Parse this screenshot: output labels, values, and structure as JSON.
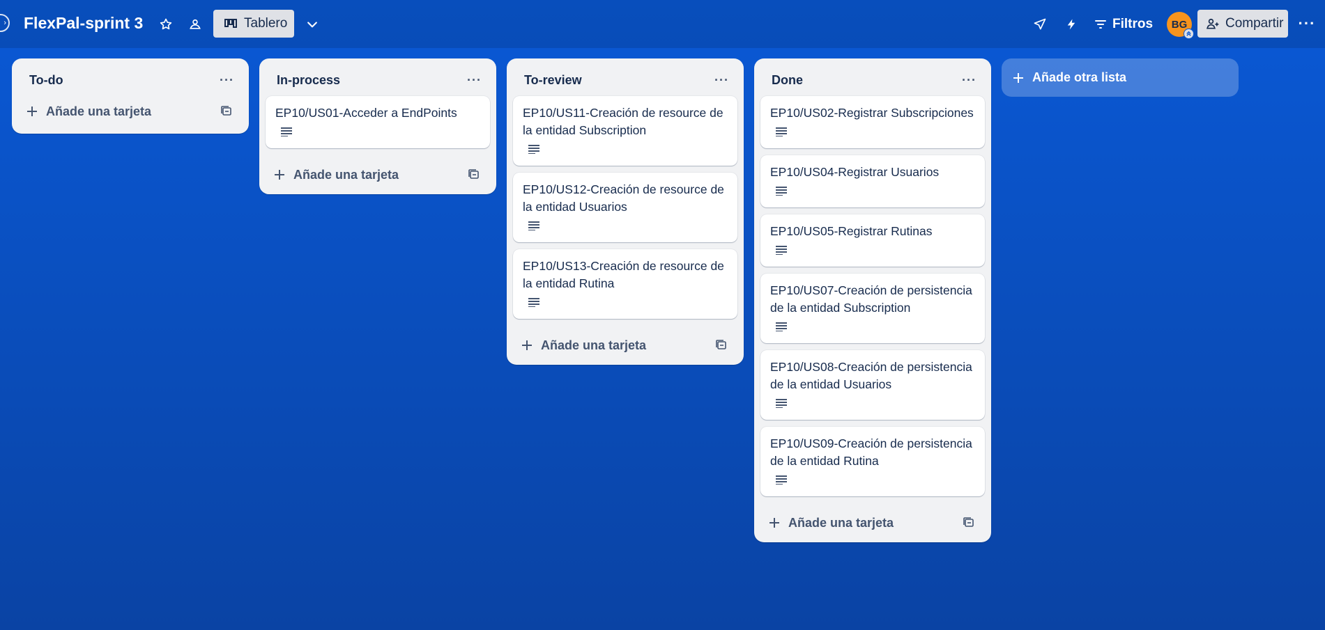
{
  "board": {
    "title": "FlexPal-sprint 3",
    "view_label": "Tablero",
    "filters_label": "Filtros",
    "share_label": "Compartir",
    "avatar_initials": "BG"
  },
  "add_card_label": "Añade una tarjeta",
  "add_list_label": "Añade otra lista",
  "lists": [
    {
      "title": "To-do",
      "cards": []
    },
    {
      "title": "In-process",
      "cards": [
        {
          "title": "EP10/US01-Acceder a EndPoints"
        }
      ]
    },
    {
      "title": "To-review",
      "cards": [
        {
          "title": "EP10/US11-Creación de resource de la entidad Subscription"
        },
        {
          "title": "EP10/US12-Creación de resource de la entidad Usuarios"
        },
        {
          "title": "EP10/US13-Creación de resource de la entidad Rutina"
        }
      ]
    },
    {
      "title": "Done",
      "cards": [
        {
          "title": "EP10/US02-Registrar Subscripciones"
        },
        {
          "title": "EP10/US04-Registrar Usuarios"
        },
        {
          "title": "EP10/US05-Registrar Rutinas"
        },
        {
          "title": "EP10/US07-Creación de persistencia de la entidad Subscription"
        },
        {
          "title": "EP10/US08-Creación de persistencia de la entidad Usuarios"
        },
        {
          "title": "EP10/US09-Creación de persistencia de la entidad Rutina"
        }
      ]
    }
  ],
  "icons": {
    "star": "star-icon",
    "visibility": "workspace-visibility-icon",
    "board_view": "board-view-icon",
    "chevron": "chevron-down-icon",
    "power_ups": "power-ups-icon",
    "automation": "automation-icon",
    "filter": "filter-icon",
    "share": "add-member-icon",
    "more": "more-icon",
    "description": "description-icon",
    "template": "card-template-icon",
    "plus": "plus-icon"
  }
}
